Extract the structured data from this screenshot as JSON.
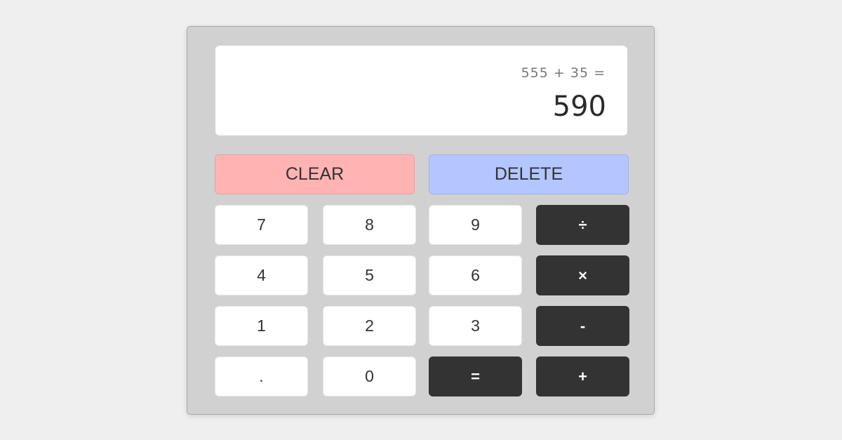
{
  "display": {
    "expression": "555 + 35 =",
    "result": "590"
  },
  "actions": {
    "clear": "CLEAR",
    "delete": "DELETE"
  },
  "keys": [
    [
      "7",
      "8",
      "9",
      "÷"
    ],
    [
      "4",
      "5",
      "6",
      "×"
    ],
    [
      "1",
      "2",
      "3",
      "-"
    ],
    [
      ".",
      "0",
      "=",
      "+"
    ]
  ],
  "colors": {
    "clear": "#ffb3b3",
    "delete": "#b3c6ff",
    "operator": "#333333",
    "number": "#ffffff",
    "background": "#d1d1d1"
  }
}
